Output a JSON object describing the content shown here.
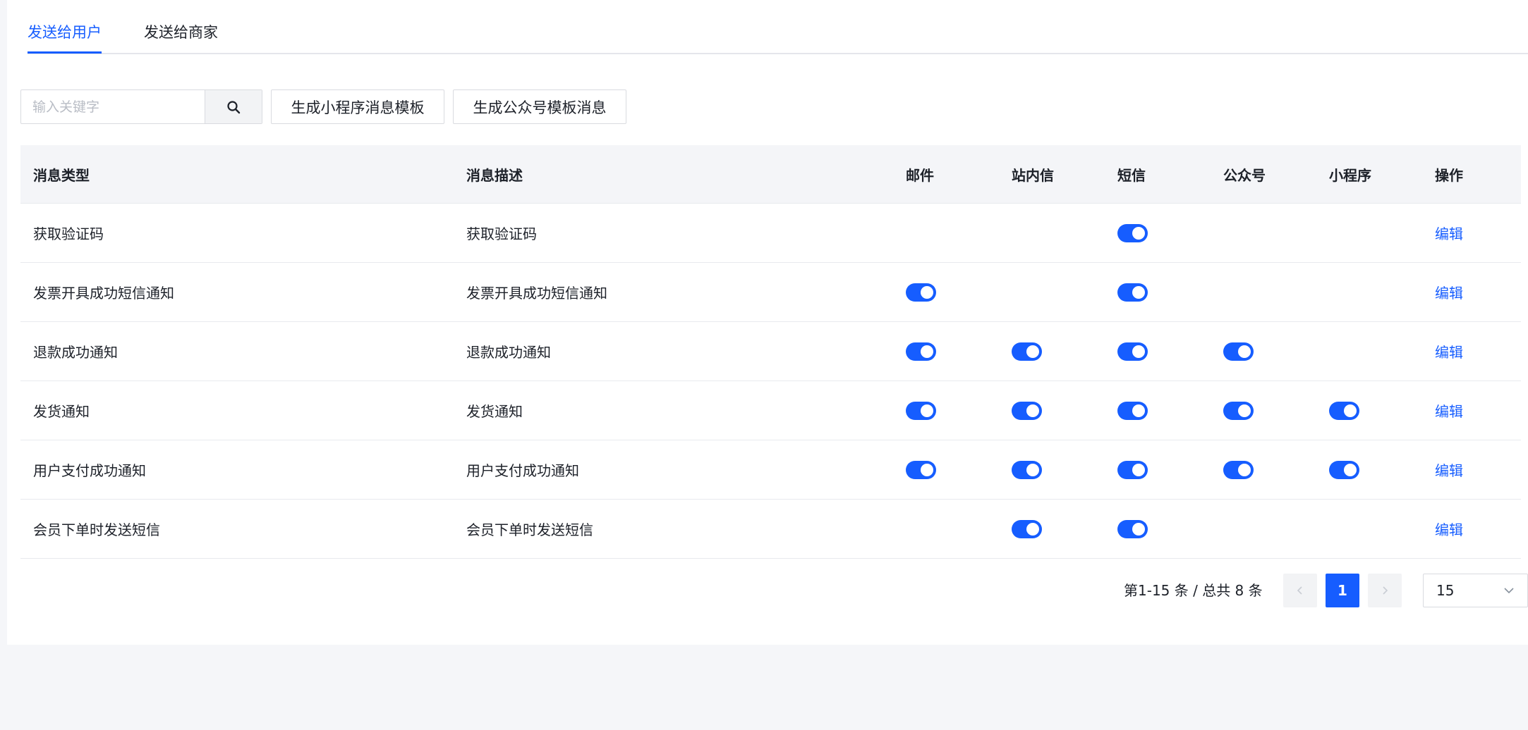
{
  "tabs": [
    {
      "label": "发送给用户",
      "active": true
    },
    {
      "label": "发送给商家",
      "active": false
    }
  ],
  "toolbar": {
    "search_placeholder": "输入关键字",
    "search_value": "",
    "btn_mini_template": "生成小程序消息模板",
    "btn_wx_template": "生成公众号模板消息"
  },
  "table": {
    "headers": {
      "type": "消息类型",
      "desc": "消息描述",
      "mail": "邮件",
      "inbox": "站内信",
      "sms": "短信",
      "wx": "公众号",
      "mini": "小程序",
      "op": "操作"
    },
    "rows": [
      {
        "type": "获取验证码",
        "desc": "获取验证码",
        "mail": false,
        "inbox": false,
        "sms": true,
        "wx": false,
        "mini": false,
        "op": "编辑"
      },
      {
        "type": "发票开具成功短信通知",
        "desc": "发票开具成功短信通知",
        "mail": true,
        "inbox": false,
        "sms": true,
        "wx": false,
        "mini": false,
        "op": "编辑"
      },
      {
        "type": "退款成功通知",
        "desc": "退款成功通知",
        "mail": true,
        "inbox": true,
        "sms": true,
        "wx": true,
        "mini": false,
        "op": "编辑"
      },
      {
        "type": "发货通知",
        "desc": "发货通知",
        "mail": true,
        "inbox": true,
        "sms": true,
        "wx": true,
        "mini": true,
        "op": "编辑"
      },
      {
        "type": "用户支付成功通知",
        "desc": "用户支付成功通知",
        "mail": true,
        "inbox": true,
        "sms": true,
        "wx": true,
        "mini": true,
        "op": "编辑"
      },
      {
        "type": "会员下单时发送短信",
        "desc": "会员下单时发送短信",
        "mail": false,
        "inbox": true,
        "sms": true,
        "wx": false,
        "mini": false,
        "op": "编辑"
      }
    ]
  },
  "pagination": {
    "total_text": "第1-15 条 / 总共 8 条",
    "current_page": "1",
    "prev_icon": "chevron-left-icon",
    "next_icon": "chevron-right-icon",
    "page_size": "15"
  },
  "colors": {
    "accent": "#165dff",
    "header_bg": "#f4f5f8",
    "page_bg": "#f5f6f9"
  }
}
